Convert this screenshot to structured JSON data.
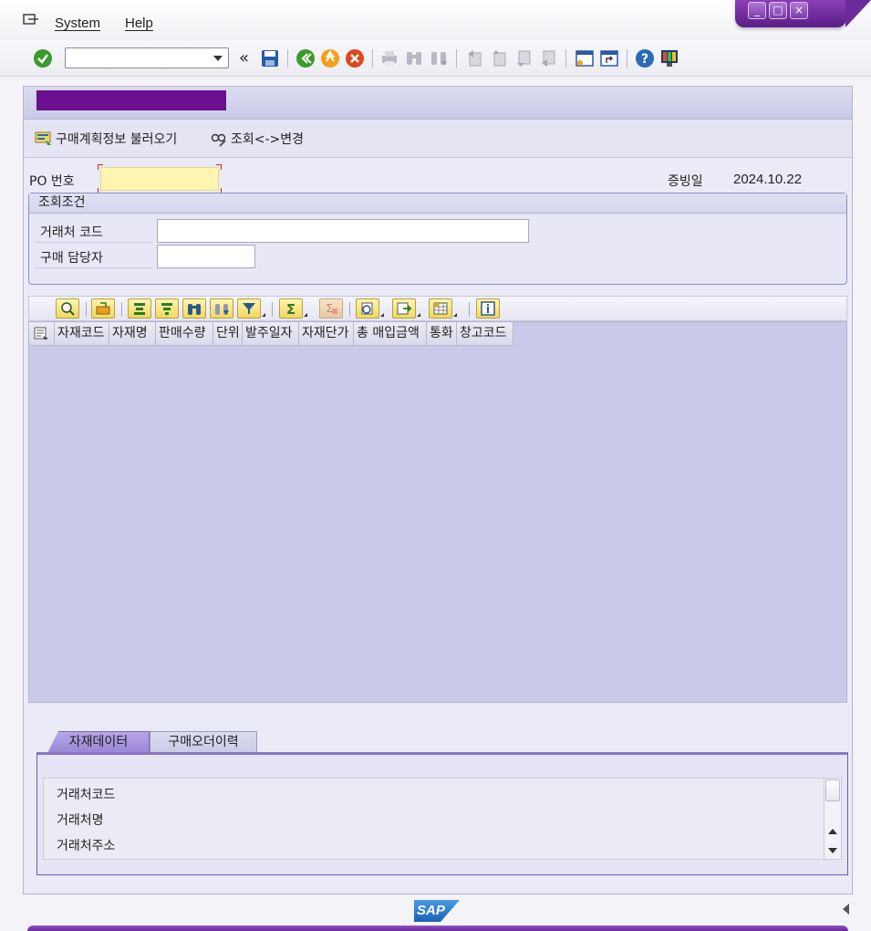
{
  "menubar": {
    "items": [
      {
        "label": "System"
      },
      {
        "label": "Help"
      }
    ]
  },
  "toolbar": {
    "command_field": {
      "value": "",
      "placeholder": ""
    },
    "back_label": "«"
  },
  "app_toolbar": {
    "load_plan_label": "구매계획정보 불러오기",
    "toggle_mode_label": "조회<->변경"
  },
  "header": {
    "po_label": "PO 번호",
    "po_value": "",
    "doc_date_label": "증빙일",
    "doc_date_value": "2024.10.22"
  },
  "search_conditions": {
    "title": "조회조건",
    "vendor_code_label": "거래처 코드",
    "vendor_code_value": "",
    "buyer_label": "구매 담당자",
    "buyer_value": ""
  },
  "grid": {
    "columns": [
      "자재코드",
      "자재명",
      "판매수량",
      "단위",
      "발주일자",
      "자재단가",
      "총 매입금액",
      "통화",
      "창고코드"
    ]
  },
  "tabs": [
    {
      "label": "자재데이터",
      "active": true
    },
    {
      "label": "구매오더이력",
      "active": false
    }
  ],
  "tab_content": {
    "lines": [
      "거래처코드",
      "거래처명",
      "거래처주소"
    ]
  },
  "status": {
    "logo": "SAP"
  },
  "colors": {
    "accent_purple": "#6a2a99",
    "title_redaction": "#6a0f8e",
    "required_field_bg": "#fff4b0",
    "grid_bg": "#cacae8"
  }
}
